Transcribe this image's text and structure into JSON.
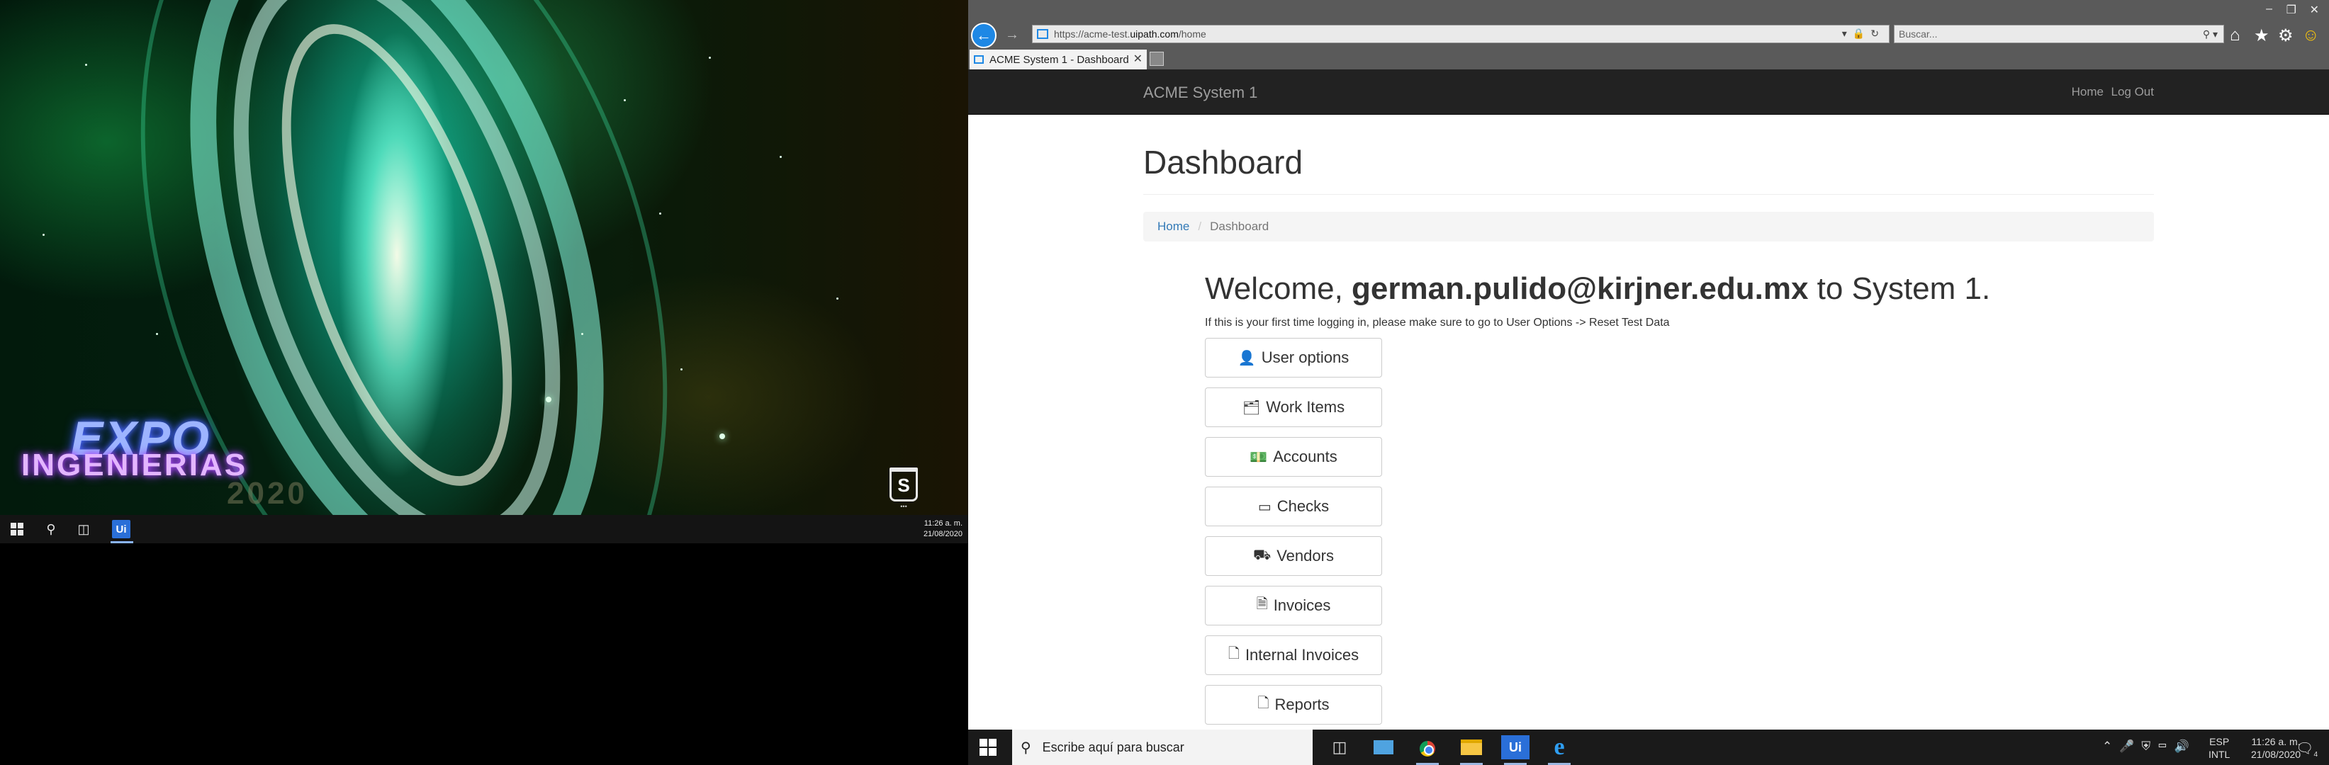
{
  "left_screen": {
    "wallpaper": {
      "logo_word_1": "EXPO",
      "logo_word_2": "INGENIERIAS",
      "logo_word_3": "2020"
    },
    "taskbar": {
      "clock_time": "11:26 a. m.",
      "clock_date": "21/08/2020",
      "uipath_label": "Ui"
    }
  },
  "browser": {
    "url_prefix": "https://acme-test.",
    "url_host": "uipath.com",
    "url_path": "/home",
    "search_placeholder": "Buscar...",
    "tab_title": "ACME System 1 - Dashboard",
    "icons": [
      "back-arrow-icon",
      "forward-arrow-icon",
      "lock-icon",
      "refresh-icon",
      "home-icon",
      "star-icon",
      "gear-icon",
      "smiley-icon"
    ]
  },
  "app": {
    "brand": "ACME System 1",
    "nav": {
      "home": "Home",
      "logout": "Log Out"
    },
    "page_title": "Dashboard",
    "breadcrumb": {
      "home": "Home",
      "separator": "/",
      "current": "Dashboard"
    },
    "welcome": {
      "prefix": "Welcome,",
      "user": "german.pulido@kirjner.edu.mx",
      "suffix": "to System 1.",
      "note": "If this is your first time logging in, please make sure to go to User Options -> Reset Test Data"
    },
    "menu": [
      {
        "label": "User options",
        "icon": "user-icon"
      },
      {
        "label": "Work Items",
        "icon": "folder-open-icon"
      },
      {
        "label": "Accounts",
        "icon": "money-icon"
      },
      {
        "label": "Checks",
        "icon": "credit-card-icon"
      },
      {
        "label": "Vendors",
        "icon": "truck-icon"
      },
      {
        "label": "Invoices",
        "icon": "file-text-icon"
      },
      {
        "label": "Internal Invoices",
        "icon": "file-icon"
      },
      {
        "label": "Reports",
        "icon": "file-outline-icon"
      }
    ]
  },
  "right_taskbar": {
    "search_placeholder": "Escribe aquí para buscar",
    "uipath_label": "Ui",
    "lang_1": "ESP",
    "lang_2": "INTL",
    "clock_time": "11:26 a. m.",
    "clock_date": "21/08/2020",
    "notification_count": "4"
  }
}
